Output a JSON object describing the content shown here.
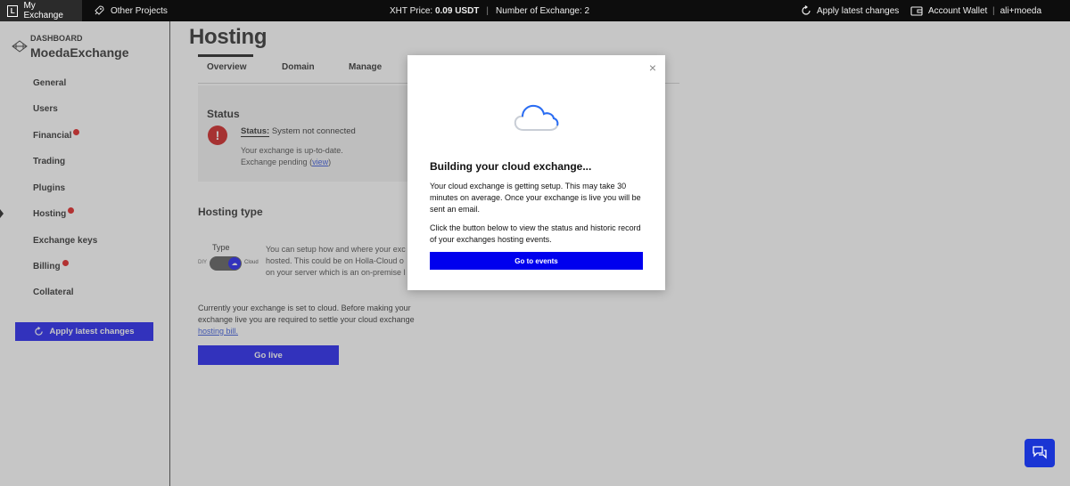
{
  "topbar": {
    "my_exchange": "My Exchange",
    "other_projects": "Other Projects",
    "xht_label": "XHT Price:",
    "xht_value": "0.09 USDT",
    "separator": "|",
    "num_exchange": "Number of Exchange: 2",
    "apply_changes": "Apply latest changes",
    "account_wallet": "Account Wallet",
    "user": "ali+moeda"
  },
  "sidebar": {
    "dashboard_label": "DASHBOARD",
    "exchange_name": "MoedaExchange",
    "items": [
      {
        "label": "General",
        "badge": false
      },
      {
        "label": "Users",
        "badge": false
      },
      {
        "label": "Financial",
        "badge": true
      },
      {
        "label": "Trading",
        "badge": false
      },
      {
        "label": "Plugins",
        "badge": false
      },
      {
        "label": "Hosting",
        "badge": true
      },
      {
        "label": "Exchange keys",
        "badge": false
      },
      {
        "label": "Billing",
        "badge": true
      },
      {
        "label": "Collateral",
        "badge": false
      }
    ],
    "apply_button": "Apply latest changes"
  },
  "main": {
    "title": "Hosting",
    "tabs": [
      "Overview",
      "Domain",
      "Manage"
    ],
    "status": {
      "heading": "Status",
      "label": "Status:",
      "value": "System not connected",
      "line1": "Your exchange is up-to-date.",
      "line2_prefix": "Exchange pending (",
      "line2_link": "view",
      "line2_suffix": ")"
    },
    "hosting_type": {
      "heading": "Hosting type",
      "type_label": "Type",
      "toggle_left": "DIY",
      "toggle_right": "Cloud",
      "desc": "You can setup how and where your exc hosted. This could be on Holla-Cloud o on your server which is an on-premise l"
    },
    "current_text": "Currently your exchange is set to cloud. Before making your exchange live you are required to settle your cloud exchange",
    "current_link": "hosting bill.",
    "go_live": "Go live"
  },
  "modal": {
    "close": "×",
    "title": "Building your cloud exchange...",
    "p1": "Your cloud exchange is getting setup. This may take 30 minutes on average. Once your exchange is live you will be sent an email.",
    "p2": "Click the button below to view the status and historic record of your exchanges hosting events.",
    "button": "Go to events"
  },
  "colors": {
    "accent": "#0000ee",
    "topbar": "#0d0d0d",
    "error": "#c80000",
    "chat": "#1a35d4"
  },
  "icons": [
    "logo-icon",
    "rocket-icon",
    "refresh-icon",
    "wallet-icon",
    "brand-icon",
    "error-icon",
    "cloud-icon",
    "close-icon",
    "chat-icon"
  ]
}
